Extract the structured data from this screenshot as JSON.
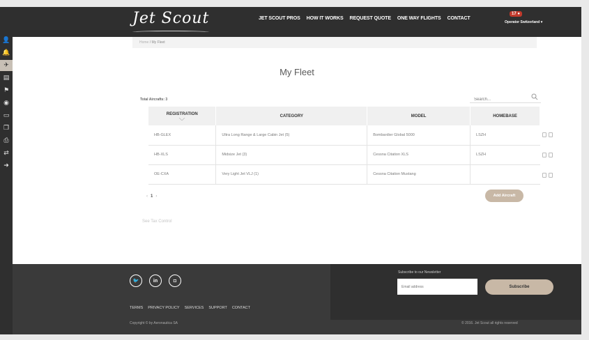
{
  "sidebar": {
    "items": [
      "user-icon",
      "bell-icon",
      "plane-icon",
      "book-icon",
      "flag-icon",
      "globe-icon",
      "car-icon",
      "copy-icon",
      "print-icon",
      "swap-icon",
      "logout-icon"
    ]
  },
  "header": {
    "logo": "Jet Scout",
    "nav": [
      "JET SCOUT PROS",
      "HOW IT WORKS",
      "REQUEST QUOTE",
      "ONE WAY FLIGHTS",
      "CONTACT"
    ],
    "badge": "17",
    "operator": "Operator Switzerland"
  },
  "breadcrumb": {
    "home": "Home",
    "current": "My Fleet"
  },
  "page_title": "My Fleet",
  "total": "Total Aircrafts: 3",
  "search": {
    "placeholder": "Search..."
  },
  "table": {
    "headers": [
      "REGISTRATION",
      "CATEGORY",
      "MODEL",
      "HOMEBASE"
    ],
    "rows": [
      [
        "HB-GLEX",
        "Ultra Long Range & Large Cabin Jet (5)",
        "Bombardier Global 5000",
        "LSZH"
      ],
      [
        "HB-XLS",
        "Midsize Jet (3)",
        "Cessna Citation XLS",
        "LSZH"
      ],
      [
        "OE-CXA",
        "Very Light Jet VLJ (1)",
        "Cessna Citation Mustang",
        ""
      ]
    ]
  },
  "pager": {
    "prev": "‹",
    "current": "1",
    "next": "›"
  },
  "add_button": "Add Aircraft",
  "terms_link": "See Tax Control",
  "footer": {
    "newsletter_label": "Subscribe to our Newsletter",
    "email_placeholder": "Email address",
    "subscribe": "Subscribe",
    "links": [
      "TERMS",
      "PRIVACY POLICY",
      "SERVICES",
      "SUPPORT",
      "CONTACT"
    ],
    "copyright": "Copyright © by Aeronautica SA",
    "rights": "© 2016. Jet Scout all rights reserved"
  }
}
